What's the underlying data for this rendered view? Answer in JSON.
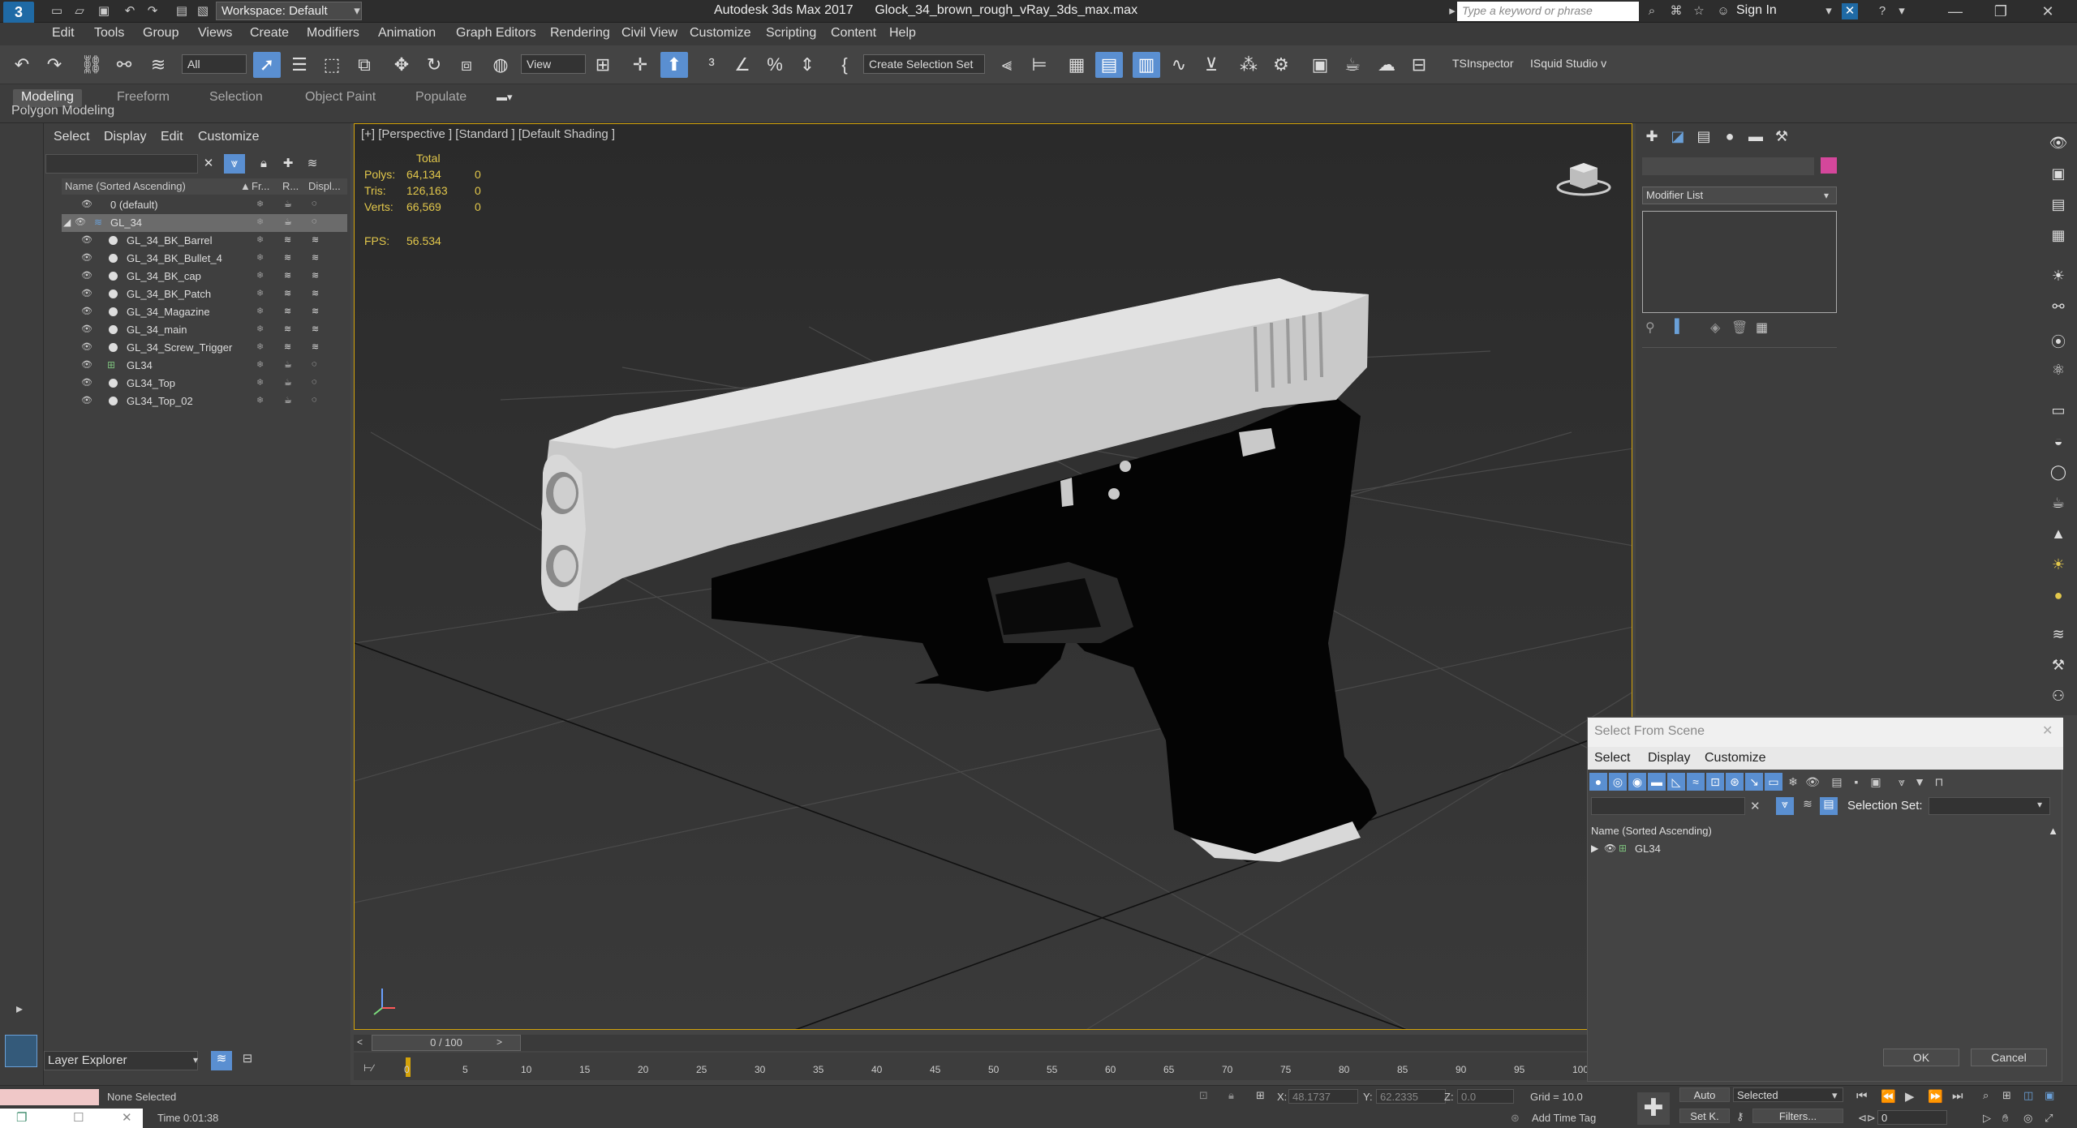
{
  "titlebar": {
    "logo": "3",
    "workspace": "Workspace: Default",
    "title": "Autodesk 3ds Max 2017      Glock_34_brown_rough_vRay_3ds_max.max",
    "search_placeholder": "Type a keyword or phrase",
    "signin": "Sign In"
  },
  "menubar": [
    "Edit",
    "Tools",
    "Group",
    "Views",
    "Create",
    "Modifiers",
    "Animation",
    "Graph Editors",
    "Rendering",
    "Civil View",
    "Customize",
    "Scripting",
    "Content",
    "Help"
  ],
  "toolbar": {
    "filter": "All",
    "view": "View",
    "selection_set": "Create Selection Set",
    "tsinspector": "TSInspector",
    "isquid": "ISquid Studio v"
  },
  "ribbon": {
    "tabs": [
      "Modeling",
      "Freeform",
      "Selection",
      "Object Paint",
      "Populate"
    ],
    "sub_label": "Polygon Modeling"
  },
  "explorer": {
    "menu": [
      "Select",
      "Display",
      "Edit",
      "Customize"
    ],
    "header": {
      "name": "Name (Sorted Ascending)",
      "fr": "Fr...",
      "r": "R...",
      "displ": "Displ..."
    },
    "rows": [
      {
        "label": "0 (default)"
      },
      {
        "label": "GL_34"
      },
      {
        "label": "GL_34_BK_Barrel"
      },
      {
        "label": "GL_34_BK_Bullet_4"
      },
      {
        "label": "GL_34_BK_cap"
      },
      {
        "label": "GL_34_BK_Patch"
      },
      {
        "label": "GL_34_Magazine"
      },
      {
        "label": "GL_34_main"
      },
      {
        "label": "GL_34_Screw_Trigger"
      },
      {
        "label": "GL34"
      },
      {
        "label": "GL34_Top"
      },
      {
        "label": "GL34_Top_02"
      }
    ],
    "layer_explorer": "Layer Explorer"
  },
  "viewport": {
    "label": "[+] [Perspective ] [Standard ] [Default Shading ]",
    "stats": {
      "total_label": "Total",
      "polys_label": "Polys:",
      "polys": "64,134",
      "polys_sel": "0",
      "tris_label": "Tris:",
      "tris": "126,163",
      "tris_sel": "0",
      "verts_label": "Verts:",
      "verts": "66,569",
      "verts_sel": "0",
      "fps_label": "FPS:",
      "fps": "56.534"
    }
  },
  "timeline": {
    "frame": "0 / 100",
    "ticks": [
      "0",
      "5",
      "10",
      "15",
      "20",
      "25",
      "30",
      "35",
      "40",
      "45",
      "50",
      "55",
      "60",
      "65",
      "70",
      "75",
      "80",
      "85",
      "90",
      "95",
      "100"
    ]
  },
  "statusbar": {
    "selection": "None Selected",
    "time": "Time  0:01:38",
    "x_label": "X:",
    "x": "48.1737",
    "y_label": "Y:",
    "y": "62.2335",
    "z_label": "Z:",
    "z": "0.0",
    "grid": "Grid = 10.0",
    "add_time_tag": "Add Time Tag",
    "auto": "Auto",
    "selected": "Selected",
    "setk": "Set K.",
    "filters": "Filters...",
    "frame": "0"
  },
  "cmdpanel": {
    "modifier_list": "Modifier List",
    "color": "#d4479b"
  },
  "dialog": {
    "title": "Select From Scene",
    "menu": [
      "Select",
      "Display",
      "Customize"
    ],
    "selection_set_label": "Selection Set:",
    "header": "Name (Sorted Ascending)",
    "row": "GL34",
    "ok": "OK",
    "cancel": "Cancel"
  }
}
